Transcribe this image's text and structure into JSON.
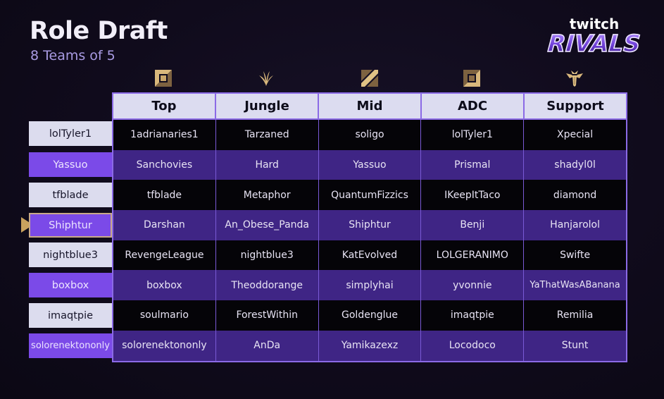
{
  "header": {
    "title": "Role Draft",
    "subtitle": "8 Teams of 5"
  },
  "logo": {
    "top_text": "twitch",
    "bottom_text": "RIVALS"
  },
  "roles": [
    {
      "label": "Top",
      "icon": "top-lane-icon"
    },
    {
      "label": "Jungle",
      "icon": "jungle-icon"
    },
    {
      "label": "Mid",
      "icon": "mid-lane-icon"
    },
    {
      "label": "ADC",
      "icon": "bot-lane-icon"
    },
    {
      "label": "Support",
      "icon": "support-icon"
    }
  ],
  "captains": [
    {
      "name": "lolTyler1",
      "style": "light",
      "selected": false
    },
    {
      "name": "Yassuo",
      "style": "violet",
      "selected": false
    },
    {
      "name": "tfblade",
      "style": "light",
      "selected": false
    },
    {
      "name": "Shiphtur",
      "style": "violet",
      "selected": true
    },
    {
      "name": "nightblue3",
      "style": "light",
      "selected": false
    },
    {
      "name": "boxbox",
      "style": "violet",
      "selected": false
    },
    {
      "name": "imaqtpie",
      "style": "light",
      "selected": false
    },
    {
      "name": "solorenektononly",
      "style": "violet",
      "selected": false
    }
  ],
  "teams": [
    [
      "1adrianaries1",
      "Tarzaned",
      "soligo",
      "lolTyler1",
      "Xpecial"
    ],
    [
      "Sanchovies",
      "Hard",
      "Yassuo",
      "Prismal",
      "shadyl0l"
    ],
    [
      "tfblade",
      "Metaphor",
      "QuantumFizzics",
      "IKeepItTaco",
      "diamond"
    ],
    [
      "Darshan",
      "An_Obese_Panda",
      "Shiphtur",
      "Benji",
      "Hanjarolol"
    ],
    [
      "RevengeLeague",
      "nightblue3",
      "KatEvolved",
      "LOLGERANIMO",
      "Swifte"
    ],
    [
      "boxbox",
      "Theoddorange",
      "simplyhai",
      "yvonnie",
      "YaThatWasABanana"
    ],
    [
      "soulmario",
      "ForestWithin",
      "Goldenglue",
      "imaqtpie",
      "Remilia"
    ],
    [
      "solorenektononly",
      "AnDa",
      "Yamikazexz",
      "Locodoco",
      "Stunt"
    ]
  ],
  "colors": {
    "accent_purple": "#7b4ae8",
    "row_purple": "#3f2585",
    "border_purple": "#8b6ae6",
    "gold": "#c9a25e",
    "header_bg": "#dcdcf0"
  }
}
